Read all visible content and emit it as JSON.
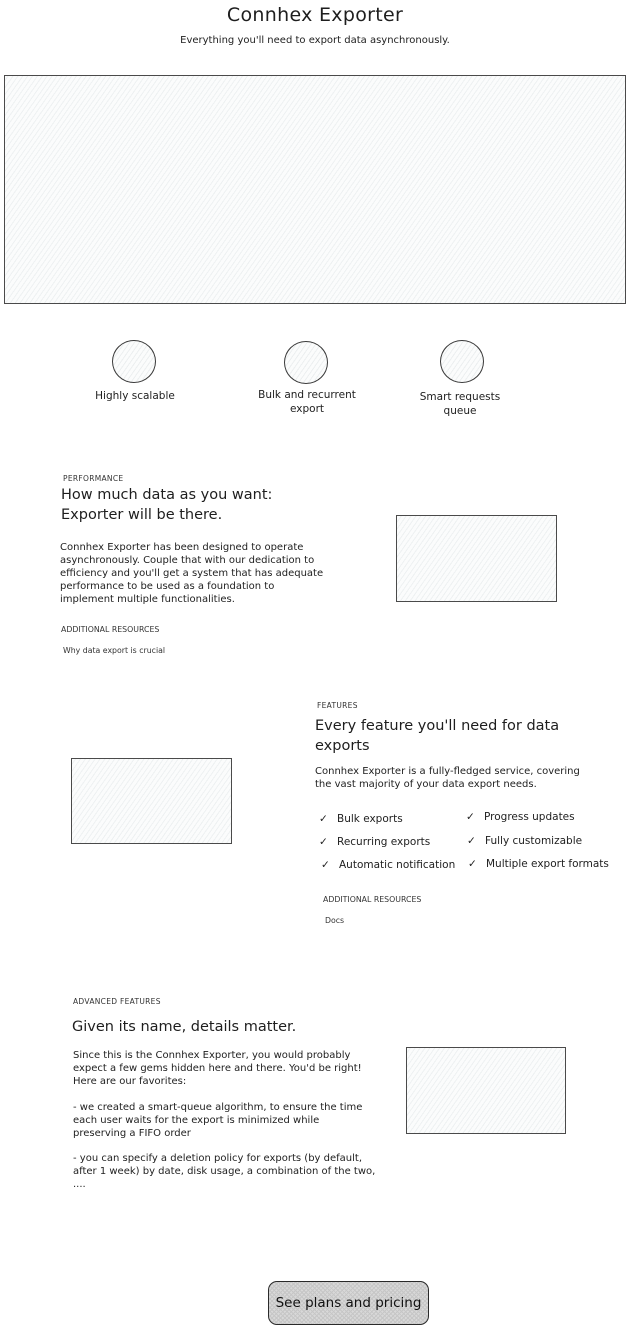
{
  "header": {
    "title": "Connhex Exporter",
    "subtitle": "Everything you'll need to export data asynchronously."
  },
  "hero": {
    "image_placeholder": "hero-image"
  },
  "highlights": [
    {
      "icon": "circle-placeholder-icon",
      "label": "Highly scalable"
    },
    {
      "icon": "circle-placeholder-icon",
      "label": "Bulk and recurrent export"
    },
    {
      "icon": "circle-placeholder-icon",
      "label": "Smart requests queue"
    }
  ],
  "performance": {
    "eyebrow": "PERFORMANCE",
    "heading_line1": "How much data as you want:",
    "heading_line2": "Exporter will be there.",
    "body": "Connhex Exporter has been designed to operate asynchronously. Couple that with our dedication to efficiency and you'll get a system that has adequate performance to be used as a foundation to implement multiple functionalities.",
    "resources_label": "ADDITIONAL RESOURCES",
    "resources": [
      "Why data export is crucial"
    ]
  },
  "features": {
    "eyebrow": "FEATURES",
    "heading": "Every feature you'll need for data exports",
    "body": "Connhex Exporter is a fully-fledged service, covering the vast majority of your data export needs.",
    "check_icon": "✓",
    "list_left": [
      "Bulk exports",
      "Recurring exports",
      "Automatic notification"
    ],
    "list_right": [
      "Progress updates",
      "Fully customizable",
      "Multiple export formats"
    ],
    "resources_label": "ADDITIONAL RESOURCES",
    "resources": [
      "Docs"
    ]
  },
  "advanced": {
    "eyebrow": "ADVANCED FEATURES",
    "heading": "Given its name, details matter.",
    "intro": "Since this is the Connhex Exporter, you would probably expect a few gems hidden here and there. You'd be right! Here are our favorites:",
    "point1": "- we created a smart-queue algorithm, to ensure the time each user waits for the export is minimized while preserving a FIFO order",
    "point2": "- you can specify a deletion policy for exports (by default, after 1 week) by date, disk usage, a combination of the two, ...."
  },
  "cta": {
    "label": "See plans and pricing"
  }
}
